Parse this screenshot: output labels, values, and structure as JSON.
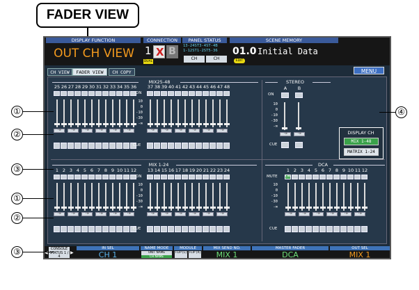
{
  "callout_title": "FADER VIEW",
  "annotations": [
    "①",
    "②",
    "③",
    "①",
    "②",
    "③",
    "④"
  ],
  "header": {
    "display_function_label": "DISPLAY FUNCTION",
    "display_function_value": "OUT CH VIEW",
    "connection_label": "CONNECTION",
    "connection_number": "1",
    "connection_mark": "X",
    "connection_b": "B",
    "connection_mode": "DUAL",
    "panel_status_label": "PANEL STATUS",
    "panel_status_line1": "13-24ST3-4ST-4B",
    "panel_status_line2": "1-12ST1-2ST5-36",
    "panel_status_btn1": "CH",
    "panel_status_btn2": "CH",
    "scene_memory_label": "SCENE MEMORY",
    "scene_number": "01.0",
    "scene_name": "Initial Data",
    "scene_edit": "EDIT"
  },
  "tabs": [
    {
      "label": "CH VIEW",
      "active": false
    },
    {
      "label": "FADER VIEW",
      "active": true
    },
    {
      "label": "CH COPY",
      "active": false
    }
  ],
  "menu_label": "MENU",
  "sections": {
    "mix25_48_title": "MIX25-48",
    "stereo_title": "STEREO",
    "mix1_24_title": "MIX 1-24",
    "dca_title": "DCA"
  },
  "mix_upper_left": [
    "25",
    "26",
    "27",
    "28",
    "29",
    "30",
    "31",
    "32",
    "33",
    "34",
    "35",
    "36"
  ],
  "mix_upper_right": [
    "37",
    "38",
    "39",
    "40",
    "41",
    "42",
    "43",
    "44",
    "45",
    "46",
    "47",
    "48"
  ],
  "mix_lower_left": [
    "1",
    "2",
    "3",
    "4",
    "5",
    "6",
    "7",
    "8",
    "9",
    "10",
    "11",
    "12"
  ],
  "mix_lower_right": [
    "13",
    "14",
    "15",
    "16",
    "17",
    "18",
    "19",
    "20",
    "21",
    "22",
    "23",
    "24"
  ],
  "stereo_channels": [
    "A",
    "B"
  ],
  "dca_channels": [
    "1",
    "2",
    "3",
    "4",
    "5",
    "6",
    "7",
    "8",
    "9",
    "10",
    "11",
    "12"
  ],
  "on_label": "ON",
  "cue_label": "CUE",
  "mute_label": "MUTE",
  "on_active_label": "ON",
  "scale_labels": [
    "10",
    "0",
    "-10",
    "-30",
    "-∞"
  ],
  "value_text": "-∞",
  "display_ch": {
    "title": "DISPLAY CH",
    "options": [
      {
        "label": "MIX 1-48",
        "selected": true
      },
      {
        "label": "MATRIX 1-24",
        "selected": false
      }
    ]
  },
  "footer": {
    "console_status": "CONSOLE STATUS 1 / 4",
    "in_sel_label": "IN SEL",
    "in_sel_value": "CH 1",
    "name_mode_label": "NAME MODE",
    "name_mode_opt1": "UNIT NAME",
    "name_mode_opt2": "CH NAME",
    "module_label": "MODULE",
    "module_opt1": "FLIP [L]",
    "module_opt2": "FLIP [R]",
    "mix_send_label": "MIX SEND NO.",
    "mix_send_value": "MIX 1",
    "master_fader_label": "MASTER FADER",
    "master_fader_value": "DCA",
    "out_sel_label": "OUT SEL",
    "out_sel_value": "MIX 1"
  },
  "colors": {
    "screen_bg": "#1d2c3a",
    "accent_orange": "#f39a1e",
    "accent_green": "#6ee07a",
    "on_green": "#3aa24a",
    "menu_blue": "#3d6fc2"
  }
}
